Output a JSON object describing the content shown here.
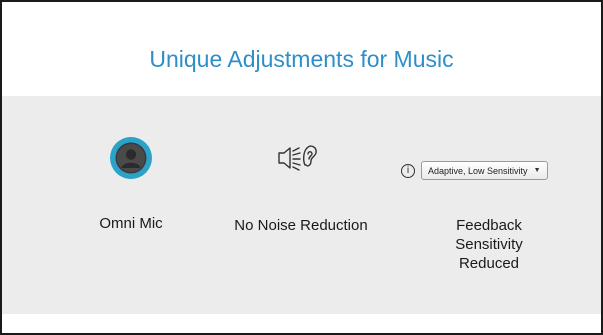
{
  "slide": {
    "title": "Unique Adjustments for Music"
  },
  "items": [
    {
      "label": "Omni Mic",
      "icon": "person-avatar-icon"
    },
    {
      "label": "No Noise Reduction",
      "icon": "ear-noise-icon"
    },
    {
      "label": "Feedback Sensitivity Reduced",
      "icon": "info-icon"
    }
  ],
  "feedback_control": {
    "selected": "Adaptive, Low Sensitivity"
  },
  "colors": {
    "title": "#2e8fc8",
    "band": "#ececec",
    "avatar": "#2ba3c9"
  }
}
